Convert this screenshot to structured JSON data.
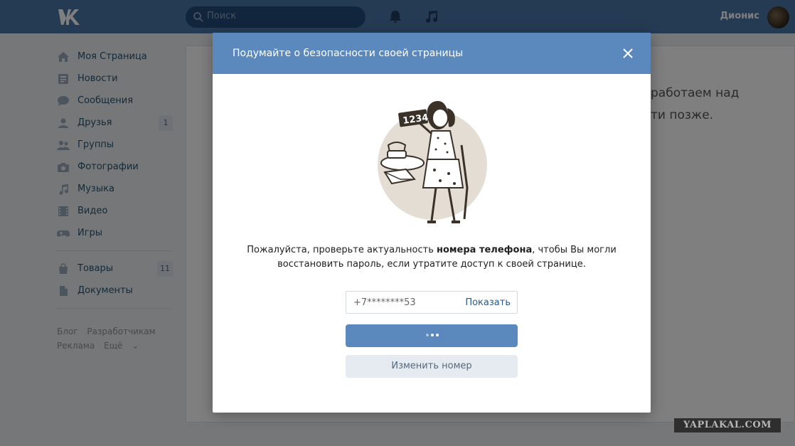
{
  "header": {
    "logo": "VK",
    "search_placeholder": "Поиск",
    "user_name": "Дионис",
    "icons": [
      "vk-logo-icon",
      "search-icon",
      "bell-icon",
      "music-icon",
      "avatar"
    ]
  },
  "sidebar": {
    "items": [
      {
        "label": "Моя Страница",
        "icon": "home-icon"
      },
      {
        "label": "Новости",
        "icon": "news-icon"
      },
      {
        "label": "Сообщения",
        "icon": "messages-icon"
      },
      {
        "label": "Друзья",
        "icon": "friends-icon",
        "count": "1"
      },
      {
        "label": "Группы",
        "icon": "groups-icon"
      },
      {
        "label": "Фотографии",
        "icon": "camera-icon"
      },
      {
        "label": "Музыка",
        "icon": "music-icon"
      },
      {
        "label": "Видео",
        "icon": "video-icon"
      },
      {
        "label": "Игры",
        "icon": "gamepad-icon"
      }
    ],
    "items2": [
      {
        "label": "Товары",
        "icon": "bag-icon",
        "count": "11"
      },
      {
        "label": "Документы",
        "icon": "document-icon"
      }
    ],
    "footer": [
      "Блог",
      "Разработчикам",
      "Реклама",
      "Ещё"
    ]
  },
  "background": {
    "line1": "работаем над",
    "line2": "ти позже."
  },
  "modal": {
    "title": "Подумайте о безопасности своей страницы",
    "message_part1": "Пожалуйста, проверьте актуальность ",
    "message_bold": "номера телефона",
    "message_part2": ", чтобы Вы могли восстановить пароль, если утратите доступ к своей странице.",
    "phone_value": "+7********53",
    "show_label": "Показать",
    "change_label": "Изменить номер",
    "illustration_text": "1234"
  },
  "watermark": "YAPLAKAL.COM",
  "colors": {
    "header": "#4a76a8",
    "modal_header": "#5b88bd",
    "link": "#2a5885"
  }
}
